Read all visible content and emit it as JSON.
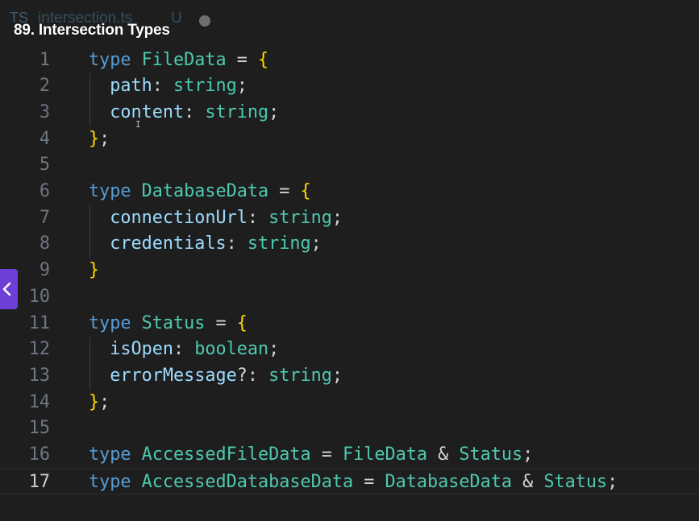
{
  "tab": {
    "lang_badge": "TS",
    "filename": "intersection.ts",
    "git_status": "U"
  },
  "lesson_title": "89. Intersection Types",
  "editor": {
    "current_line": 17,
    "lines": [
      {
        "n": "1",
        "tokens": [
          [
            "kw",
            "type"
          ],
          [
            "op",
            " "
          ],
          [
            "ty",
            "FileData"
          ],
          [
            "op",
            " = "
          ],
          [
            "br",
            "{"
          ]
        ]
      },
      {
        "n": "2",
        "tokens": [
          [
            "op",
            "  "
          ],
          [
            "prop",
            "path"
          ],
          [
            "pn",
            ": "
          ],
          [
            "ty",
            "string"
          ],
          [
            "pn",
            ";"
          ]
        ]
      },
      {
        "n": "3",
        "tokens": [
          [
            "op",
            "  "
          ],
          [
            "prop",
            "content"
          ],
          [
            "pn",
            ": "
          ],
          [
            "ty",
            "string"
          ],
          [
            "pn",
            ";"
          ]
        ]
      },
      {
        "n": "4",
        "tokens": [
          [
            "br",
            "}"
          ],
          [
            "pn",
            ";"
          ]
        ]
      },
      {
        "n": "5",
        "tokens": []
      },
      {
        "n": "6",
        "tokens": [
          [
            "kw",
            "type"
          ],
          [
            "op",
            " "
          ],
          [
            "ty",
            "DatabaseData"
          ],
          [
            "op",
            " = "
          ],
          [
            "br",
            "{"
          ]
        ]
      },
      {
        "n": "7",
        "tokens": [
          [
            "op",
            "  "
          ],
          [
            "prop",
            "connectionUrl"
          ],
          [
            "pn",
            ": "
          ],
          [
            "ty",
            "string"
          ],
          [
            "pn",
            ";"
          ]
        ]
      },
      {
        "n": "8",
        "tokens": [
          [
            "op",
            "  "
          ],
          [
            "prop",
            "credentials"
          ],
          [
            "pn",
            ": "
          ],
          [
            "ty",
            "string"
          ],
          [
            "pn",
            ";"
          ]
        ]
      },
      {
        "n": "9",
        "tokens": [
          [
            "br",
            "}"
          ]
        ]
      },
      {
        "n": "10",
        "tokens": []
      },
      {
        "n": "11",
        "tokens": [
          [
            "kw",
            "type"
          ],
          [
            "op",
            " "
          ],
          [
            "ty",
            "Status"
          ],
          [
            "op",
            " = "
          ],
          [
            "br",
            "{"
          ]
        ]
      },
      {
        "n": "12",
        "tokens": [
          [
            "op",
            "  "
          ],
          [
            "prop",
            "isOpen"
          ],
          [
            "pn",
            ": "
          ],
          [
            "ty",
            "boolean"
          ],
          [
            "pn",
            ";"
          ]
        ]
      },
      {
        "n": "13",
        "tokens": [
          [
            "op",
            "  "
          ],
          [
            "prop",
            "errorMessage"
          ],
          [
            "pn",
            "?: "
          ],
          [
            "ty",
            "string"
          ],
          [
            "pn",
            ";"
          ]
        ]
      },
      {
        "n": "14",
        "tokens": [
          [
            "br",
            "}"
          ],
          [
            "pn",
            ";"
          ]
        ]
      },
      {
        "n": "15",
        "tokens": []
      },
      {
        "n": "16",
        "tokens": [
          [
            "kw",
            "type"
          ],
          [
            "op",
            " "
          ],
          [
            "ty",
            "AccessedFileData"
          ],
          [
            "op",
            " = "
          ],
          [
            "ty",
            "FileData"
          ],
          [
            "op",
            " & "
          ],
          [
            "ty",
            "Status"
          ],
          [
            "pn",
            ";"
          ]
        ]
      },
      {
        "n": "17",
        "tokens": [
          [
            "kw",
            "type"
          ],
          [
            "op",
            " "
          ],
          [
            "ty",
            "AccessedDatabaseData"
          ],
          [
            "op",
            " = "
          ],
          [
            "ty",
            "DatabaseData"
          ],
          [
            "op",
            " & "
          ],
          [
            "ty",
            "Status"
          ],
          [
            "pn",
            ";"
          ]
        ]
      }
    ]
  },
  "colors": {
    "background": "#1e1e1e",
    "keyword": "#569cd6",
    "type": "#4ec9b0",
    "property": "#9cdcfe",
    "bracket": "#ffd700",
    "accent_button": "#6d3fd6"
  },
  "icons": {
    "side_button": "chevron-left-icon",
    "tab_modified": "dot-icon"
  }
}
